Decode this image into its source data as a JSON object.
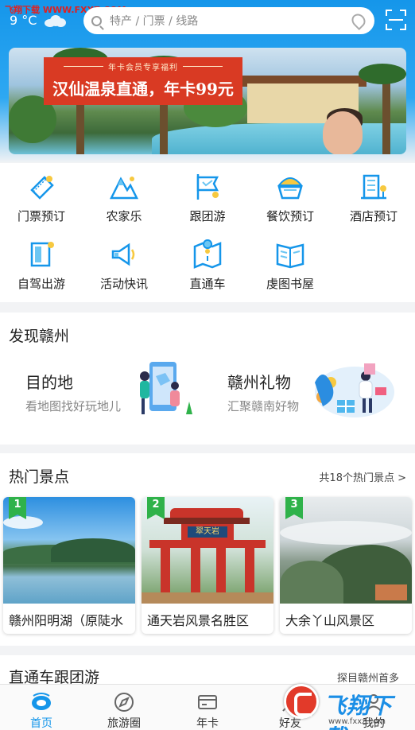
{
  "watermark_top": "飞翔下载 WWW.FXXZ.COM",
  "weather": {
    "temp": "9 °C",
    "icon": "cloud-icon"
  },
  "search": {
    "placeholder": "特产 / 门票 / 线路",
    "icon": "search-icon",
    "location_icon": "location-icon"
  },
  "scan": {
    "icon": "scan-icon"
  },
  "banner": {
    "subtitle": "年卡会员专享福利",
    "title": "汉仙温泉直通，年卡99元"
  },
  "grid": [
    {
      "label": "门票预订",
      "icon": "ticket-icon"
    },
    {
      "label": "农家乐",
      "icon": "mountain-icon"
    },
    {
      "label": "跟团游",
      "icon": "flag-icon"
    },
    {
      "label": "餐饮预订",
      "icon": "food-icon"
    },
    {
      "label": "酒店预订",
      "icon": "hotel-icon"
    },
    {
      "label": "自驾出游",
      "icon": "door-icon"
    },
    {
      "label": "活动快讯",
      "icon": "megaphone-icon"
    },
    {
      "label": "直通车",
      "icon": "map-icon"
    },
    {
      "label": "虔图书屋",
      "icon": "book-icon"
    }
  ],
  "discover": {
    "title": "发现赣州",
    "cards": [
      {
        "title": "目的地",
        "subtitle": "看地图找好玩地儿"
      },
      {
        "title": "赣州礼物",
        "subtitle": "汇聚赣南好物"
      }
    ]
  },
  "hot": {
    "title": "热门景点",
    "more": "共18个热门景点 >",
    "spots": [
      {
        "rank": "1",
        "name": "赣州阳明湖（原陡水"
      },
      {
        "rank": "2",
        "name": "通天岩风景名胜区",
        "sign": "翠天岩"
      },
      {
        "rank": "3",
        "name": "大余丫山风景区"
      }
    ]
  },
  "next_section": {
    "title": "直通车跟团游",
    "more": "探目赣州首多"
  },
  "tabs": [
    {
      "label": "首页",
      "icon": "home-icon",
      "active": true
    },
    {
      "label": "旅游圈",
      "icon": "compass-icon"
    },
    {
      "label": "年卡",
      "icon": "card-icon"
    },
    {
      "label": "好友",
      "icon": "friends-icon"
    },
    {
      "label": "我的",
      "icon": "profile-icon"
    }
  ],
  "watermark": {
    "text": "飞翔下载",
    "url": "www.fxxz.com"
  },
  "colors": {
    "primary": "#1596ea",
    "promo_red": "#d93a23",
    "rank_green": "#2fb24a"
  }
}
